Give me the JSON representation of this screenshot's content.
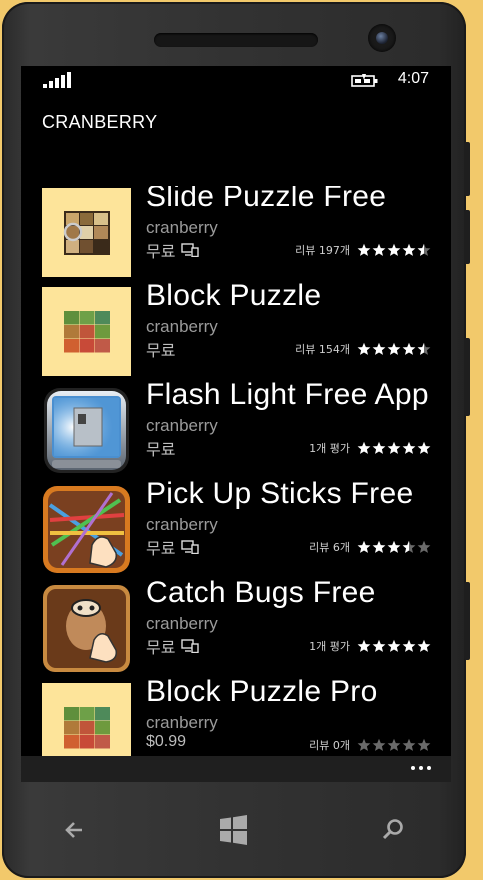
{
  "status_bar": {
    "time": "4:07",
    "icons": [
      "signal-icon",
      "battery-charging-icon"
    ]
  },
  "app": {
    "title": "CRANBERRY"
  },
  "apps": [
    {
      "name": "Slide Puzzle Free",
      "publisher": "cranberry",
      "price": "무료",
      "device_icon": true,
      "rating_text": "리뷰 197개",
      "stars": 4.5,
      "icon": "slide-puzzle-icon"
    },
    {
      "name": "Block Puzzle",
      "publisher": "cranberry",
      "price": "무료",
      "device_icon": false,
      "rating_text": "리뷰 154개",
      "stars": 4.5,
      "icon": "block-puzzle-icon"
    },
    {
      "name": "Flash Light Free App",
      "publisher": "cranberry",
      "price": "무료",
      "device_icon": false,
      "rating_text": "1개 평가",
      "stars": 5,
      "icon": "flashlight-icon"
    },
    {
      "name": "Pick Up Sticks Free",
      "publisher": "cranberry",
      "price": "무료",
      "device_icon": true,
      "rating_text": "리뷰 6개",
      "stars": 3.5,
      "icon": "pick-up-sticks-icon"
    },
    {
      "name": "Catch Bugs Free",
      "publisher": "cranberry",
      "price": "무료",
      "device_icon": true,
      "rating_text": "1개 평가",
      "stars": 5,
      "icon": "catch-bugs-icon"
    },
    {
      "name": "Block Puzzle Pro",
      "publisher": "cranberry",
      "price": "$0.99",
      "device_icon": false,
      "rating_text": "리뷰 0개",
      "stars": 0,
      "icon": "block-puzzle-icon"
    }
  ],
  "colors": {
    "background": "#f2c96b",
    "tile_bg": "#fde49a",
    "star_on": "#ffffff",
    "star_off": "#6a6a6a"
  },
  "nav": {
    "back": "back-arrow-icon",
    "start": "windows-start-icon",
    "search": "search-icon"
  }
}
